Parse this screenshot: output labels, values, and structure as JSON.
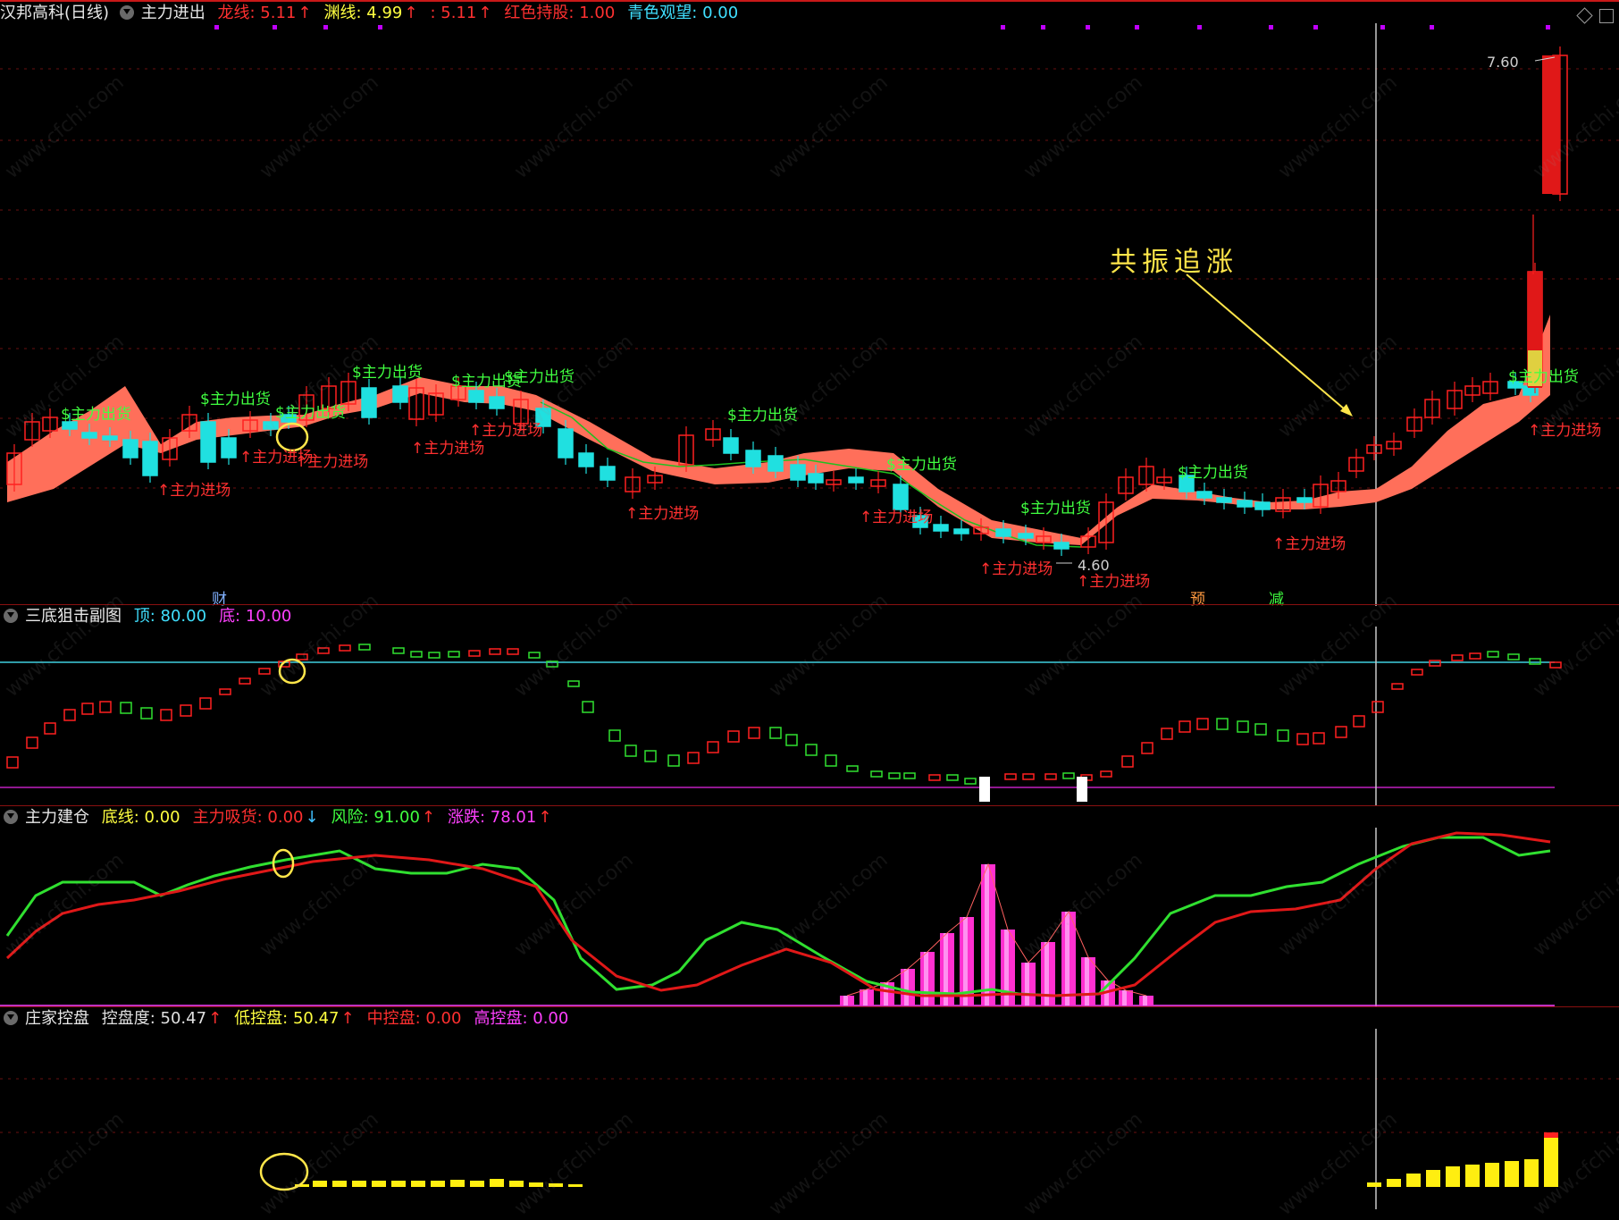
{
  "main": {
    "stock_name": "汉邦高科(日线)",
    "indicator": "主力进出",
    "metrics": [
      {
        "label": "龙线: 5.11",
        "arrow": "↑",
        "color": "#ff3030"
      },
      {
        "label": "渊线: 4.99",
        "arrow": "↑",
        "color": "#ffff40"
      },
      {
        "label": ": 5.11",
        "arrow": "↑",
        "color": "#ff3030"
      },
      {
        "label": "红色持股: 1.00",
        "arrow": "",
        "color": "#ff3030"
      },
      {
        "label": "青色观望: 0.00",
        "arrow": "",
        "color": "#40e0ff"
      }
    ],
    "annotation": "共振追涨",
    "price_high": "7.60",
    "price_low": "4.60",
    "sell_label": "主力出货",
    "buy_label": "主力进场",
    "markers": {
      "cai": "财",
      "yu": "预",
      "jian": "减"
    }
  },
  "sub1": {
    "title": "三底狙击副图",
    "metrics": [
      {
        "label": "顶: 80.00",
        "color": "#40e0ff"
      },
      {
        "label": "底: 10.00",
        "color": "#ff40ff"
      }
    ]
  },
  "sub2": {
    "title": "主力建仓",
    "metrics": [
      {
        "label": "底线: 0.00",
        "arrow": "",
        "color": "#ffff40"
      },
      {
        "label": "主力吸货: 0.00",
        "arrow": "↓",
        "color": "#ff3030",
        "arrow_color": "#40c0ff"
      },
      {
        "label": "风险: 91.00",
        "arrow": "↑",
        "color": "#40ff40",
        "arrow_color": "#ff3030"
      },
      {
        "label": "涨跌: 78.01",
        "arrow": "↑",
        "color": "#ff40ff",
        "arrow_color": "#ff3030"
      }
    ]
  },
  "sub3": {
    "title": "庄家控盘",
    "metrics": [
      {
        "label": "控盘度: 50.47",
        "arrow": "↑",
        "color": "#e0e0e0"
      },
      {
        "label": "低控盘: 50.47",
        "arrow": "↑",
        "color": "#ffff40"
      },
      {
        "label": "中控盘: 0.00",
        "arrow": "",
        "color": "#ff3030"
      },
      {
        "label": "高控盘: 0.00",
        "arrow": "",
        "color": "#ff40ff"
      }
    ]
  },
  "watermark": "www.cfchi.com",
  "colors": {
    "up": "#ff2020",
    "down": "#20e0e0",
    "band": "#ff6f5a"
  }
}
